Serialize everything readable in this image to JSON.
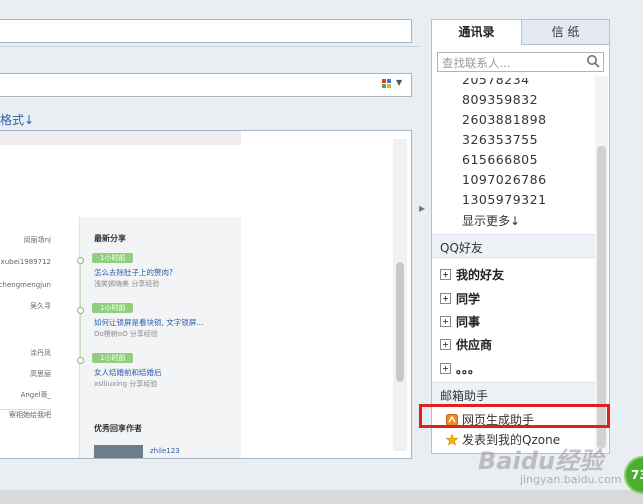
{
  "compose": {
    "format_link": "格式↓"
  },
  "editor_preview": {
    "names": [
      "闵丽场nj",
      "xubei1989712",
      "chengmengjun",
      "吴久寻",
      "涂丹凤",
      "高思丽",
      "Angel哥_",
      "察相她给我吧"
    ],
    "section_latest_share": "最新分享",
    "shares": [
      {
        "badge": "1小时前",
        "title": "怎么去除肚子上的赘肉?",
        "meta": "浅笑嫣嗨美   分享经验"
      },
      {
        "badge": "1小时前",
        "title": "如何让锁屏是看块锁, 文字锁屏...",
        "meta": "Oo楞树oO   分享经验"
      },
      {
        "badge": "1小时前",
        "title": "女人结婚前和结婚后",
        "meta": "xslliuxing   分享经验"
      }
    ],
    "section_excellent_authors": "优秀回享作者",
    "author_name": "zhile123"
  },
  "panel": {
    "tabs": {
      "contacts": "通讯录",
      "letters": "信  纸"
    },
    "search_placeholder": "查找联系人...",
    "numbers": [
      "20578234",
      "809359832",
      "2603881898",
      "326353755",
      "615666805",
      "1097026786",
      "1305979321"
    ],
    "show_more": "显示更多↓",
    "qq_friends_title": "QQ好友",
    "groups": [
      "我的好友",
      "同学",
      "同事",
      "供应商",
      "。。。"
    ],
    "mail_helper_title": "邮箱助手",
    "tools": {
      "webpage_helper": "网页生成助手",
      "post_qzone": "发表到我的Qzone"
    }
  },
  "overlay": {
    "badge_count": "73",
    "watermark": "Baidu经验",
    "watermark_url": "jingyan.baidu.com"
  },
  "colors": {
    "link": "#2a5fa8",
    "highlight_box": "#e0201c",
    "timeline_badge": "#8fcf7d"
  }
}
